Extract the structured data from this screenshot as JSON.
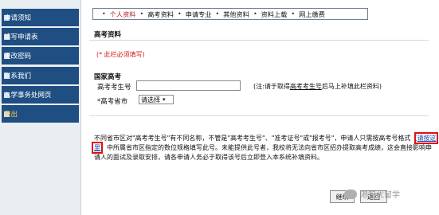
{
  "sidebar": {
    "items": [
      {
        "label": "申请须知",
        "active": false
      },
      {
        "label": "填写申请表",
        "active": false
      },
      {
        "label": "更改密码",
        "active": false
      },
      {
        "label": "联系我们",
        "active": false
      },
      {
        "label": "入学事务处网页",
        "active": false
      },
      {
        "label": "登出",
        "active": true
      }
    ]
  },
  "tabs": [
    {
      "label": "个人资料",
      "active": true
    },
    {
      "label": "高考资料",
      "active": false
    },
    {
      "label": "申请专业",
      "active": false
    },
    {
      "label": "其他资料",
      "active": false
    },
    {
      "label": "资料上载",
      "active": false
    },
    {
      "label": "网上缴费",
      "active": false
    }
  ],
  "section": {
    "title": "高考资料",
    "required_note": "(* 此栏必须填写)",
    "subhead": "国家高考"
  },
  "form": {
    "exam_number_label": "高考考生号",
    "exam_number_value": "",
    "hint_prefix": "(注:请于取得",
    "hint_underlined": "高考考生号",
    "hint_suffix": "后马上补填此栏资料)",
    "province_label": "*高考省市",
    "province_selected": "请选择"
  },
  "notice": {
    "part1": "不同省市区对\"高考考生号\"有不同名称，不管是\"高考考生号\"、\"准考证号\"或\"报考号\"，申请人只需按高考号格式（",
    "link": "请按这里",
    "part2": "）中所属省市区指定的数位规格填写此号。未能提供此号者，我校将无法向省市区招办提取高考成绩，这会直接影响申请人的面试及录取安排，请各申请人务必于取得该号后立即登入本系统补填资料。"
  },
  "buttons": {
    "continue": "继续",
    "back": "返回"
  },
  "watermark": {
    "text": "港智优留学"
  }
}
